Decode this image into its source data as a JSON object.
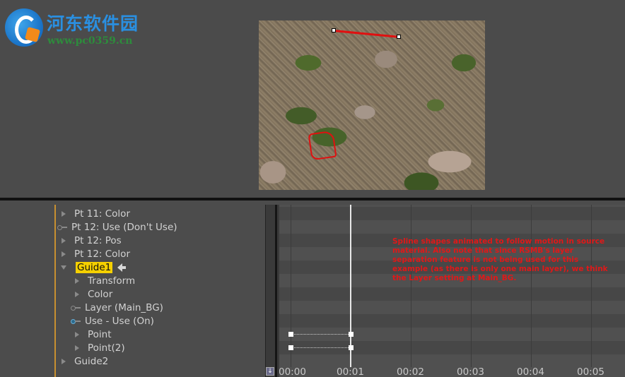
{
  "watermark": {
    "title": "河东软件园",
    "url": "www.pc0359.cn"
  },
  "tree": {
    "rows": [
      {
        "label": "Pt 11: Color",
        "icon": "expand-arrow"
      },
      {
        "label": "Pt 12: Use  (Don't Use)",
        "icon": "key-icon"
      },
      {
        "label": "Pt 12: Pos",
        "icon": "expand-arrow"
      },
      {
        "label": "Pt 12: Color",
        "icon": "expand-arrow"
      },
      {
        "label": "Guide1",
        "icon": "collapse-arrow",
        "selected": true
      },
      {
        "label": "Transform",
        "icon": "expand-arrow"
      },
      {
        "label": "Color",
        "icon": "expand-arrow"
      },
      {
        "label": "Layer  (Main_BG)",
        "icon": "key-icon"
      },
      {
        "label": "Use - Use  (On)",
        "icon": "key-icon"
      },
      {
        "label": "Point",
        "icon": "expand-arrow"
      },
      {
        "label": "Point(2)",
        "icon": "expand-arrow"
      },
      {
        "label": "Guide2",
        "icon": "expand-arrow"
      }
    ]
  },
  "timeline": {
    "note": "Spline shapes animated to follow motion in source material.  Also note that since RSMB's layer separation feature is not being used for this example (as there is only one main layer), we think the Layer setting at Main_BG.",
    "ticks": [
      "00:00",
      "00:01",
      "00:02",
      "00:03",
      "00:04",
      "00:05"
    ]
  },
  "colors": {
    "selection": "#f5d000",
    "annotation": "#e01818",
    "folder_edge": "#c89030"
  }
}
